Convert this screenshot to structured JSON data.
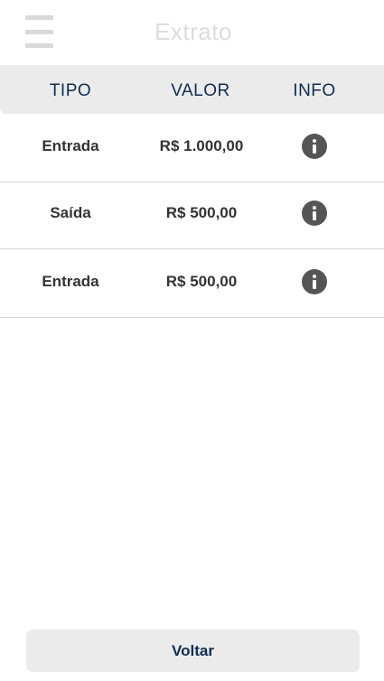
{
  "header": {
    "title": "Extrato",
    "menu_icon": "hamburger-menu-icon"
  },
  "table": {
    "columns": [
      "TIPO",
      "VALOR",
      "INFO"
    ],
    "rows": [
      {
        "tipo": "Entrada",
        "valor": "R$ 1.000,00",
        "info_icon": "info-icon"
      },
      {
        "tipo": "Saída",
        "valor": "R$ 500,00",
        "info_icon": "info-icon"
      },
      {
        "tipo": "Entrada",
        "valor": "R$ 500,00",
        "info_icon": "info-icon"
      }
    ]
  },
  "footer": {
    "back_label": "Voltar"
  },
  "colors": {
    "header_text": "#0d2d55",
    "title_text": "#dcdcdc",
    "cell_text": "#333333",
    "icon": "#555555",
    "header_bg": "#ebebeb"
  }
}
